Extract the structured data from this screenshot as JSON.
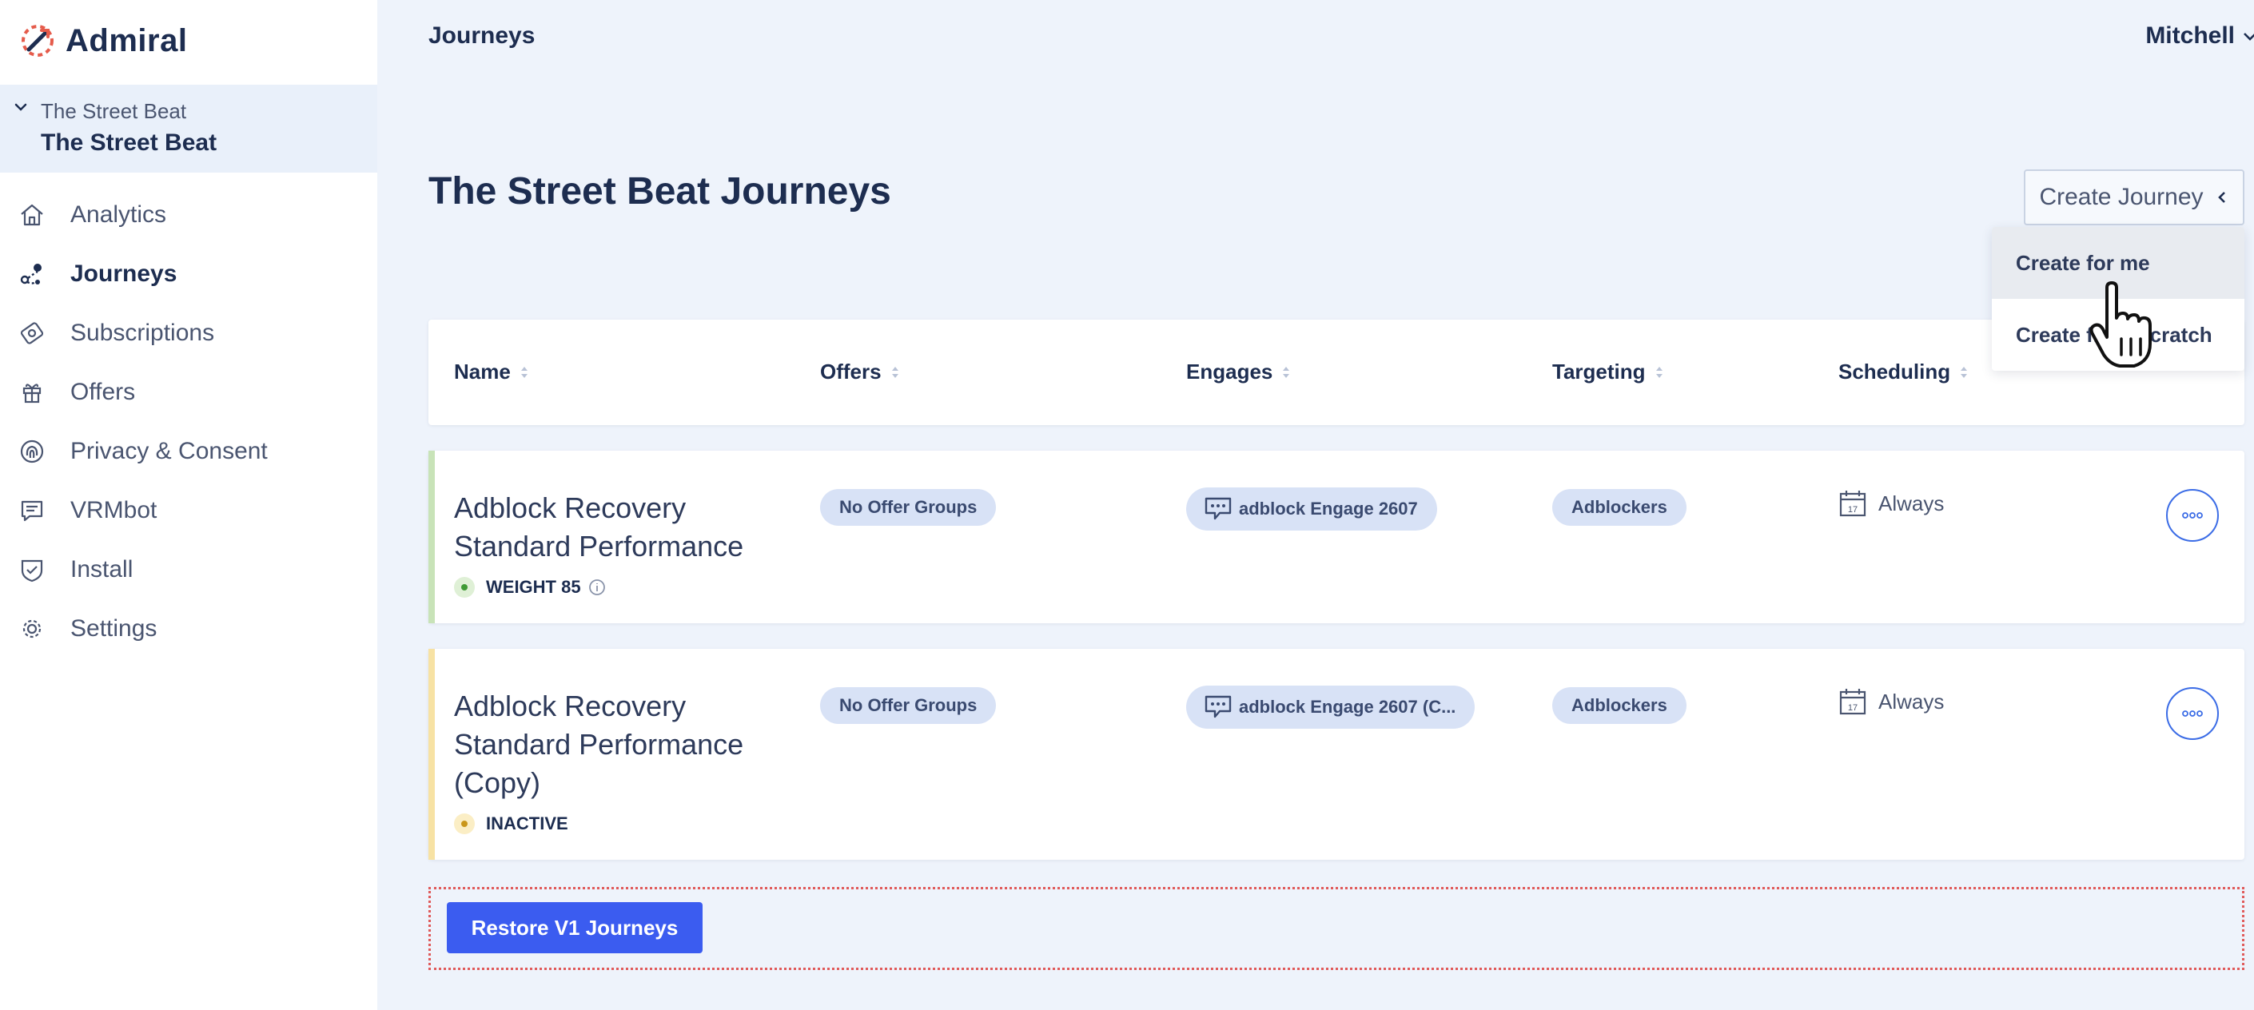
{
  "app": {
    "brand": "Admiral"
  },
  "site_switcher": {
    "parent": "The Street Beat",
    "current": "The Street Beat"
  },
  "sidebar": {
    "items": [
      {
        "label": "Analytics",
        "icon": "home-icon"
      },
      {
        "label": "Journeys",
        "icon": "journeys-icon",
        "active": true
      },
      {
        "label": "Subscriptions",
        "icon": "subscriptions-icon"
      },
      {
        "label": "Offers",
        "icon": "gift-icon"
      },
      {
        "label": "Privacy & Consent",
        "icon": "fingerprint-icon"
      },
      {
        "label": "VRMbot",
        "icon": "chat-icon"
      },
      {
        "label": "Install",
        "icon": "shield-check-icon"
      },
      {
        "label": "Settings",
        "icon": "gear-icon"
      }
    ]
  },
  "header": {
    "title": "Journeys",
    "user": "Mitchell"
  },
  "main": {
    "title": "The Street Beat Journeys",
    "create_button": "Create Journey",
    "dropdown": {
      "options": [
        "Create for me",
        "Create from scratch"
      ]
    },
    "columns": [
      "Name",
      "Offers",
      "Engages",
      "Targeting",
      "Scheduling"
    ],
    "rows": [
      {
        "name_line1": "Adblock Recovery",
        "name_line2": "Standard Performance",
        "status": "WEIGHT 85",
        "status_color": "#6abf5e",
        "offers": "No Offer Groups",
        "engages": "adblock Engage 2607",
        "targeting": "Adblockers",
        "scheduling": "Always"
      },
      {
        "name_line1": "Adblock Recovery",
        "name_line2": "Standard Performance",
        "name_line3": "(Copy)",
        "status": "INACTIVE",
        "status_color": "#f2c94c",
        "offers": "No Offer Groups",
        "engages": "adblock Engage 2607 (C...",
        "targeting": "Adblockers",
        "scheduling": "Always"
      }
    ],
    "restore_button": "Restore V1 Journeys"
  },
  "colors": {
    "primary": "#3b5cf0",
    "background": "#eef3fb",
    "active_bar": "#c8e3b8",
    "inactive_bar": "#f7e2a4"
  }
}
